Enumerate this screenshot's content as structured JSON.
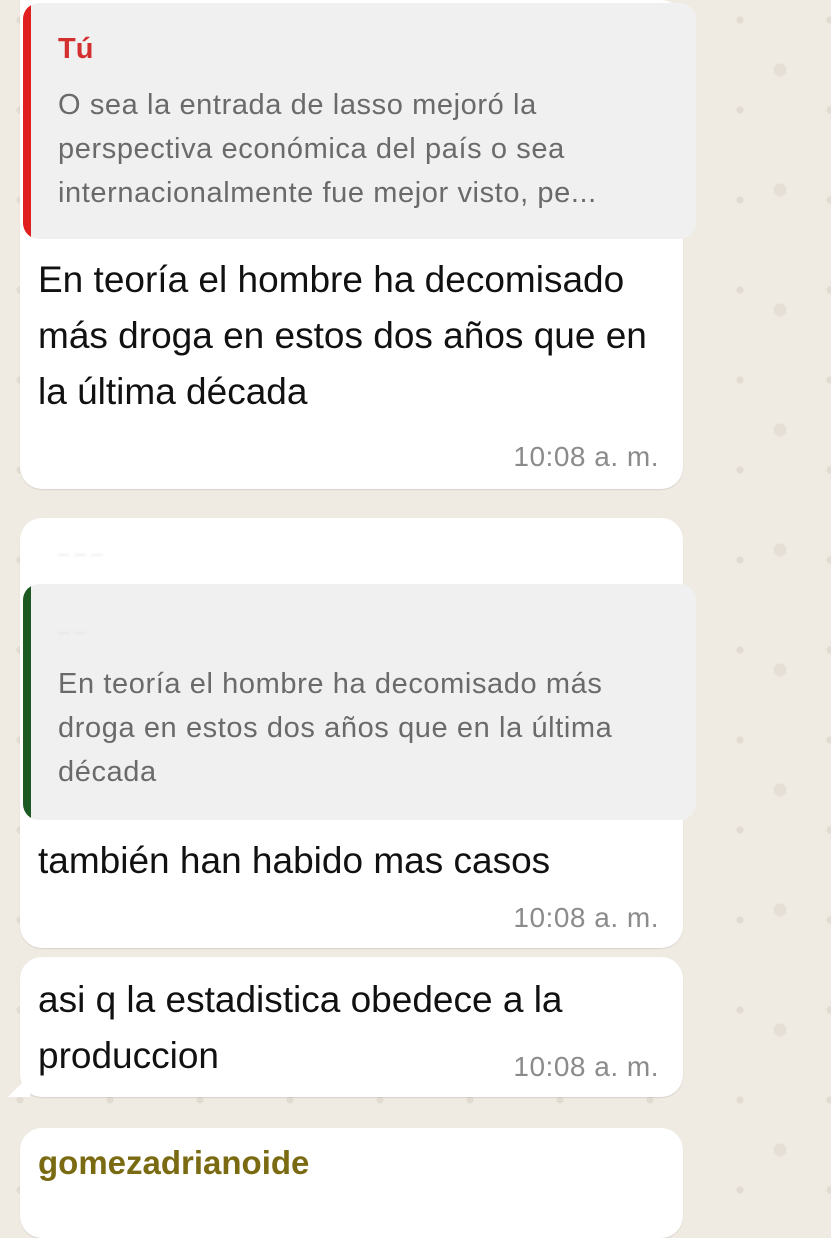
{
  "theme": {
    "chat_background": "#efeae2",
    "bubble_background": "#ffffff",
    "quote_background": "#f0f0f0",
    "quote_bar_red": "#e0201f",
    "quote_bar_green": "#1d5a23",
    "author_red": "#d32f2f",
    "sender_name_color": "#7a6a12",
    "timestamp_color": "#8b8b8b"
  },
  "messages": [
    {
      "reply": {
        "author": "Tú",
        "text": "O sea la entrada de lasso mejoró la perspectiva económica del país o sea internacionalmente fue mejor visto, pe..."
      },
      "text": "En teoría el hombre ha decomisado más droga en estos dos años que en la última década",
      "time": "10:08 a. m."
    },
    {
      "reply": {
        "text": "En teoría el hombre ha decomisado más droga en estos dos años que en la última década"
      },
      "text": "también han habido mas casos",
      "time": "10:08 a. m."
    },
    {
      "text": "asi q la estadistica obedece a la produccion",
      "time": "10:08 a. m."
    },
    {
      "sender": "gomezadrianoide"
    }
  ]
}
